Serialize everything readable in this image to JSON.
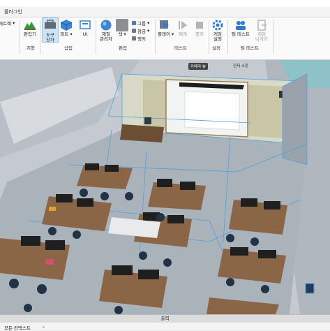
{
  "menubar": {
    "title": "플러그인"
  },
  "ribbon": {
    "left_partial": "레트랙",
    "tools": [
      {
        "label": "편집기",
        "icon": "terrain-editor-icon"
      },
      {
        "label": "도구\n상자",
        "icon": "toolbox-icon"
      },
      {
        "label": "파트",
        "icon": "part-cube-icon"
      },
      {
        "label": "UI",
        "icon": "ui-icon"
      },
      {
        "label": "재질\n관리자",
        "icon": "material-manager-icon"
      },
      {
        "label": "색",
        "icon": "color-icon"
      },
      {
        "label": "플레이",
        "icon": "play-icon"
      },
      {
        "label": "재개",
        "icon": "resume-icon"
      },
      {
        "label": "중지",
        "icon": "stop-icon"
      },
      {
        "label": "게임\n설정",
        "icon": "game-settings-icon"
      },
      {
        "label": "팀 테스트",
        "icon": "team-test-icon"
      },
      {
        "label": "게임\n나가기",
        "icon": "exit-game-icon"
      }
    ],
    "small_items": [
      "그룹",
      "잠금",
      "앵커"
    ],
    "groups": [
      "지형",
      "삽입",
      "편집",
      "테스트",
      "설정",
      "팀 테스트"
    ],
    "colors": {
      "accent": "#2f7ad8",
      "toolbox_bg": "#cfe3f7"
    }
  },
  "viewport": {
    "tooltip": "카메라 뷰",
    "hint": "현재 소환"
  },
  "output": {
    "label": "출력"
  },
  "bottom": {
    "tab": "모든 컨텍스트",
    "dropdown": "⌄"
  }
}
